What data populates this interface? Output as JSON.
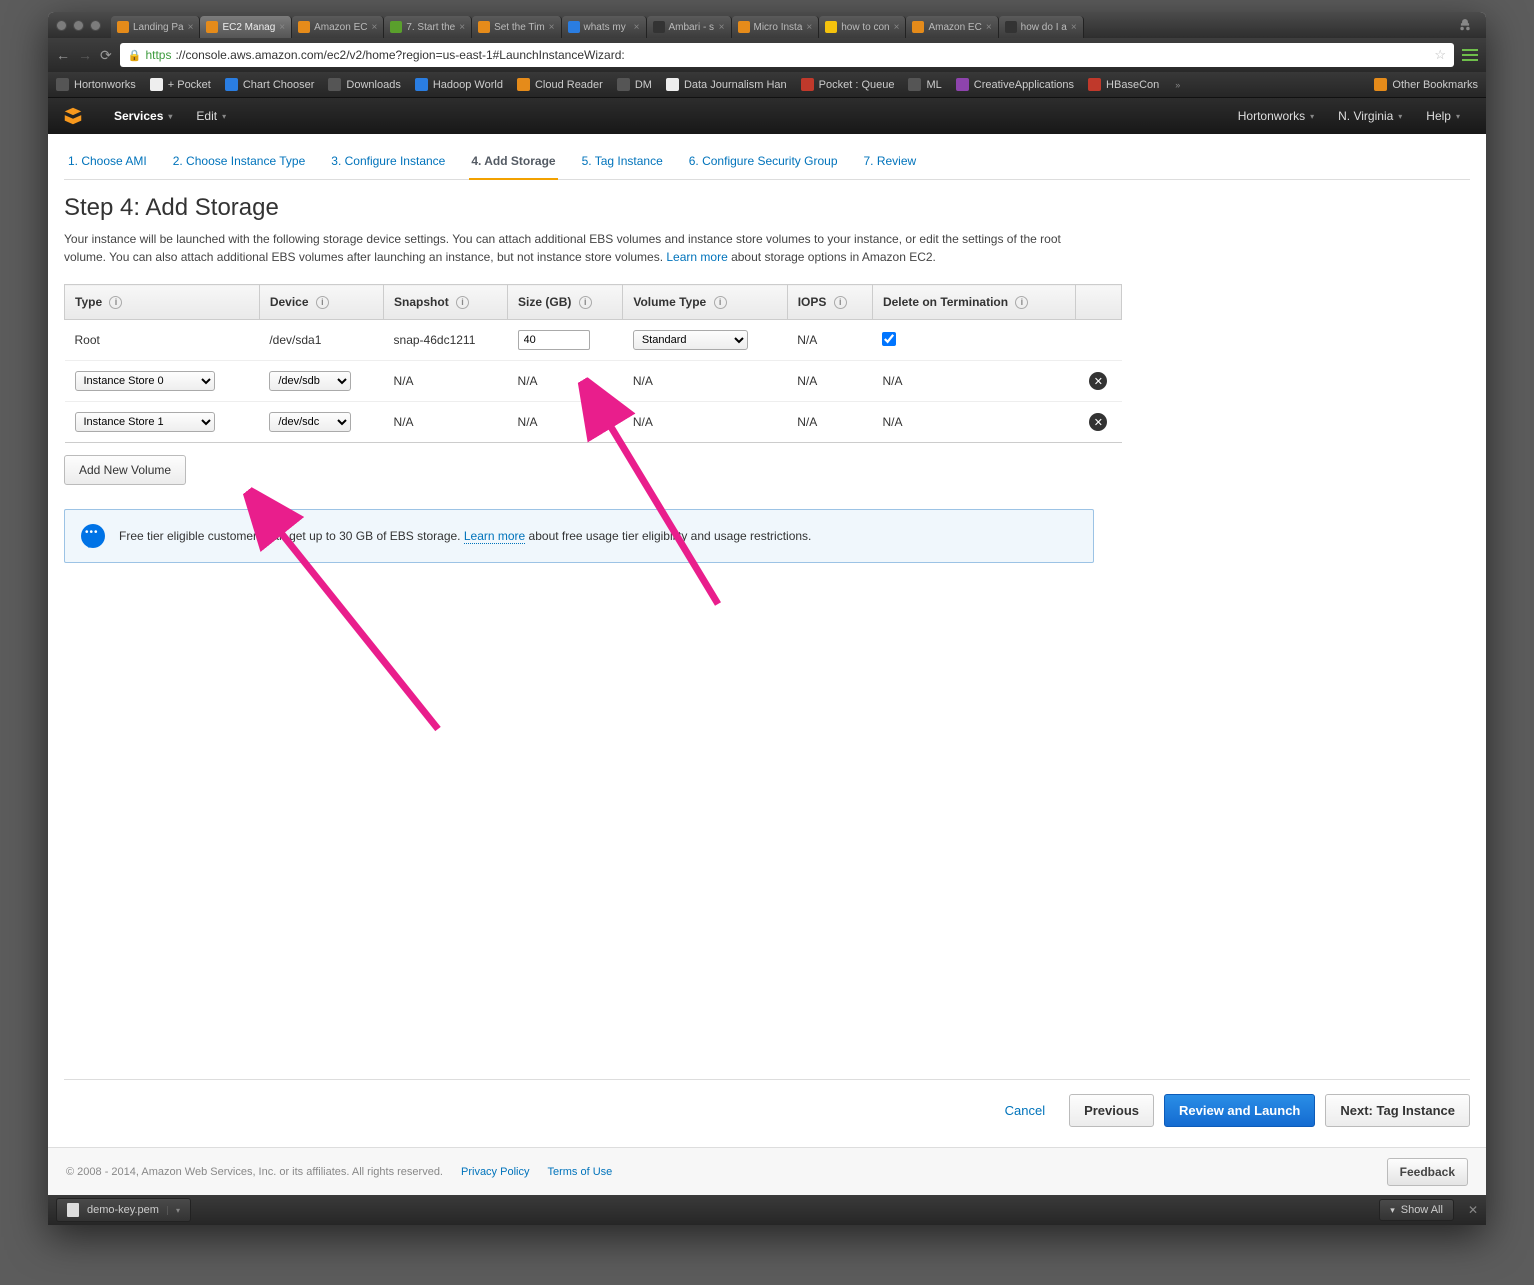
{
  "browser": {
    "tabs": [
      {
        "label": "Landing Pa",
        "fav": "o"
      },
      {
        "label": "EC2 Manag",
        "fav": "o",
        "active": true
      },
      {
        "label": "Amazon EC",
        "fav": "o"
      },
      {
        "label": "7. Start the",
        "fav": "green"
      },
      {
        "label": "Set the Tim",
        "fav": "o"
      },
      {
        "label": "whats my",
        "fav": "blue"
      },
      {
        "label": "Ambari - s",
        "fav": "dark"
      },
      {
        "label": "Micro Insta",
        "fav": "o"
      },
      {
        "label": "how to con",
        "fav": "y"
      },
      {
        "label": "Amazon EC",
        "fav": "o"
      },
      {
        "label": "how do I a",
        "fav": "dark"
      }
    ],
    "url_https": "https",
    "url_rest": "://console.aws.amazon.com/ec2/v2/home?region=us-east-1#LaunchInstanceWizard:"
  },
  "bookmarks": [
    {
      "label": "Hortonworks",
      "ico": "g"
    },
    {
      "label": "+ Pocket",
      "ico": "w"
    },
    {
      "label": "Chart Chooser",
      "ico": "b"
    },
    {
      "label": "Downloads",
      "ico": "g"
    },
    {
      "label": "Hadoop World",
      "ico": "b"
    },
    {
      "label": "Cloud Reader",
      "ico": "o"
    },
    {
      "label": "DM",
      "ico": "g"
    },
    {
      "label": "Data Journalism Han",
      "ico": "w"
    },
    {
      "label": "Pocket : Queue",
      "ico": "r"
    },
    {
      "label": "ML",
      "ico": "g"
    },
    {
      "label": "CreativeApplications",
      "ico": "p"
    },
    {
      "label": "HBaseCon",
      "ico": "r"
    }
  ],
  "bookmarks_overflow": "»",
  "other_bookmarks": "Other Bookmarks",
  "aws_header": {
    "services": "Services",
    "edit": "Edit",
    "account": "Hortonworks",
    "region": "N. Virginia",
    "help": "Help"
  },
  "wizard": {
    "steps": [
      "1. Choose AMI",
      "2. Choose Instance Type",
      "3. Configure Instance",
      "4. Add Storage",
      "5. Tag Instance",
      "6. Configure Security Group",
      "7. Review"
    ],
    "active_index": 3
  },
  "page": {
    "title": "Step 4: Add Storage",
    "desc_1": "Your instance will be launched with the following storage device settings. You can attach additional EBS volumes and instance store volumes to your instance, or edit the settings of the root volume. You can also attach additional EBS volumes after launching an instance, but not instance store volumes. ",
    "learn_more": "Learn more",
    "desc_2": " about storage options in Amazon EC2."
  },
  "table": {
    "headers": [
      "Type",
      "Device",
      "Snapshot",
      "Size (GB)",
      "Volume Type",
      "IOPS",
      "Delete on Termination",
      ""
    ],
    "rows": [
      {
        "type_text": "Root",
        "device_text": "/dev/sda1",
        "snapshot": "snap-46dc1211",
        "size": "40",
        "voltype": "Standard",
        "iops": "N/A",
        "delete_checked": true,
        "removable": false
      },
      {
        "type_select": "Instance Store 0",
        "device_select": "/dev/sdb",
        "snapshot": "N/A",
        "size_text": "N/A",
        "voltype_text": "N/A",
        "iops": "N/A",
        "delete_text": "N/A",
        "removable": true
      },
      {
        "type_select": "Instance Store 1",
        "device_select": "/dev/sdc",
        "snapshot": "N/A",
        "size_text": "N/A",
        "voltype_text": "N/A",
        "iops": "N/A",
        "delete_text": "N/A",
        "removable": true
      }
    ]
  },
  "add_volume": "Add New Volume",
  "notice": {
    "text_1": "Free tier eligible customers can get up to 30 GB of EBS storage. ",
    "link": "Learn more",
    "text_2": " about free usage tier eligibility and usage restrictions."
  },
  "footer": {
    "cancel": "Cancel",
    "previous": "Previous",
    "review": "Review and Launch",
    "next": "Next: Tag Instance"
  },
  "legal": {
    "copyright": "© 2008 - 2014, Amazon Web Services, Inc. or its affiliates. All rights reserved.",
    "privacy": "Privacy Policy",
    "terms": "Terms of Use",
    "feedback": "Feedback"
  },
  "downloads": {
    "file": "demo-key.pem",
    "show_all": "Show All"
  }
}
